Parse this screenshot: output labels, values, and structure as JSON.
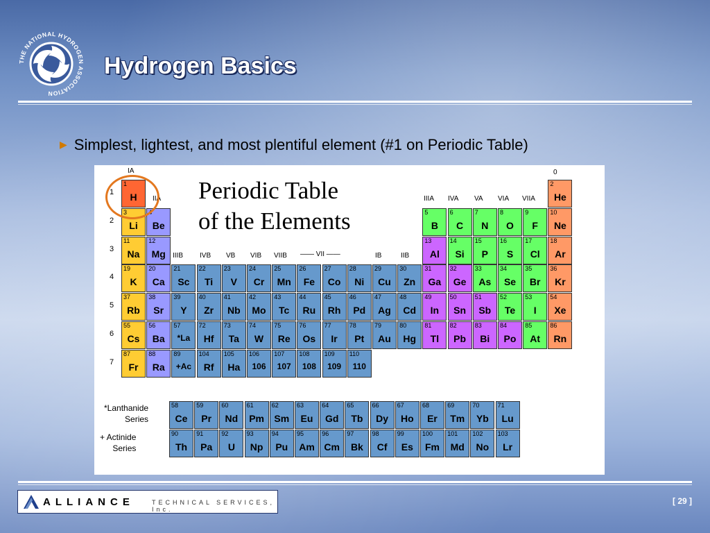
{
  "slide": {
    "title": "Hydrogen Basics",
    "bullet": "Simplest, lightest, and most plentiful element (#1 on Periodic Table)",
    "page_label": "[ 29 ]"
  },
  "logo": {
    "text": "THE NATIONAL HYDROGEN ASSOCIATION",
    "icon": "swirl-logo-icon"
  },
  "footer": {
    "brand": "ALLIANCE",
    "subtitle": "TECHNICAL SERVICES, Inc.",
    "icon": "alliance-a-icon"
  },
  "periodic_table": {
    "title_line1": "Periodic Table",
    "title_line2": "of the Elements",
    "group_labels": [
      "IA",
      "IIA",
      "IIIB",
      "IVB",
      "VB",
      "VIB",
      "VIIB",
      "—— VII ——",
      "IB",
      "IIB",
      "IIIA",
      "IVA",
      "VA",
      "VIA",
      "VIIA",
      "0"
    ],
    "periods": [
      "1",
      "2",
      "3",
      "4",
      "5",
      "6",
      "7"
    ],
    "lanthanide_label": [
      "*Lanthanide",
      "Series"
    ],
    "actinide_label": [
      "+ Actinide",
      "Series"
    ],
    "colors": {
      "hydrogen": "#ff6633",
      "alkali": "#ffcc33",
      "alkaline": "#9999ff",
      "transition": "#6699cc",
      "metalloid": "#cc66ff",
      "nonmetal": "#66ff66",
      "noble": "#ff9966",
      "series": "#6699cc"
    },
    "main": [
      {
        "n": "1",
        "s": "H",
        "c": "hydrogen"
      },
      {
        "n": "2",
        "s": "He",
        "c": "noble"
      },
      {
        "n": "3",
        "s": "Li",
        "c": "alkali"
      },
      {
        "n": "4",
        "s": "Be",
        "c": "alkaline"
      },
      {
        "n": "5",
        "s": "B",
        "c": "nonmetal"
      },
      {
        "n": "6",
        "s": "C",
        "c": "nonmetal"
      },
      {
        "n": "7",
        "s": "N",
        "c": "nonmetal"
      },
      {
        "n": "8",
        "s": "O",
        "c": "nonmetal"
      },
      {
        "n": "9",
        "s": "F",
        "c": "nonmetal"
      },
      {
        "n": "10",
        "s": "Ne",
        "c": "noble"
      },
      {
        "n": "11",
        "s": "Na",
        "c": "alkali"
      },
      {
        "n": "12",
        "s": "Mg",
        "c": "alkaline"
      },
      {
        "n": "13",
        "s": "Al",
        "c": "metalloid"
      },
      {
        "n": "14",
        "s": "Si",
        "c": "nonmetal"
      },
      {
        "n": "15",
        "s": "P",
        "c": "nonmetal"
      },
      {
        "n": "16",
        "s": "S",
        "c": "nonmetal"
      },
      {
        "n": "17",
        "s": "Cl",
        "c": "nonmetal"
      },
      {
        "n": "18",
        "s": "Ar",
        "c": "noble"
      },
      {
        "n": "19",
        "s": "K",
        "c": "alkali"
      },
      {
        "n": "20",
        "s": "Ca",
        "c": "alkaline"
      },
      {
        "n": "21",
        "s": "Sc",
        "c": "transition"
      },
      {
        "n": "22",
        "s": "Ti",
        "c": "transition"
      },
      {
        "n": "23",
        "s": "V",
        "c": "transition"
      },
      {
        "n": "24",
        "s": "Cr",
        "c": "transition"
      },
      {
        "n": "25",
        "s": "Mn",
        "c": "transition"
      },
      {
        "n": "26",
        "s": "Fe",
        "c": "transition"
      },
      {
        "n": "27",
        "s": "Co",
        "c": "transition"
      },
      {
        "n": "28",
        "s": "Ni",
        "c": "transition"
      },
      {
        "n": "29",
        "s": "Cu",
        "c": "transition"
      },
      {
        "n": "30",
        "s": "Zn",
        "c": "transition"
      },
      {
        "n": "31",
        "s": "Ga",
        "c": "metalloid"
      },
      {
        "n": "32",
        "s": "Ge",
        "c": "metalloid"
      },
      {
        "n": "33",
        "s": "As",
        "c": "nonmetal"
      },
      {
        "n": "34",
        "s": "Se",
        "c": "nonmetal"
      },
      {
        "n": "35",
        "s": "Br",
        "c": "nonmetal"
      },
      {
        "n": "36",
        "s": "Kr",
        "c": "noble"
      },
      {
        "n": "37",
        "s": "Rb",
        "c": "alkali"
      },
      {
        "n": "38",
        "s": "Sr",
        "c": "alkaline"
      },
      {
        "n": "39",
        "s": "Y",
        "c": "transition"
      },
      {
        "n": "40",
        "s": "Zr",
        "c": "transition"
      },
      {
        "n": "41",
        "s": "Nb",
        "c": "transition"
      },
      {
        "n": "42",
        "s": "Mo",
        "c": "transition"
      },
      {
        "n": "43",
        "s": "Tc",
        "c": "transition"
      },
      {
        "n": "44",
        "s": "Ru",
        "c": "transition"
      },
      {
        "n": "45",
        "s": "Rh",
        "c": "transition"
      },
      {
        "n": "46",
        "s": "Pd",
        "c": "transition"
      },
      {
        "n": "47",
        "s": "Ag",
        "c": "transition"
      },
      {
        "n": "48",
        "s": "Cd",
        "c": "transition"
      },
      {
        "n": "49",
        "s": "In",
        "c": "metalloid"
      },
      {
        "n": "50",
        "s": "Sn",
        "c": "metalloid"
      },
      {
        "n": "51",
        "s": "Sb",
        "c": "metalloid"
      },
      {
        "n": "52",
        "s": "Te",
        "c": "nonmetal"
      },
      {
        "n": "53",
        "s": "I",
        "c": "nonmetal"
      },
      {
        "n": "54",
        "s": "Xe",
        "c": "noble"
      },
      {
        "n": "55",
        "s": "Cs",
        "c": "alkali"
      },
      {
        "n": "56",
        "s": "Ba",
        "c": "alkaline"
      },
      {
        "n": "57",
        "s": "*La",
        "c": "transition"
      },
      {
        "n": "72",
        "s": "Hf",
        "c": "transition"
      },
      {
        "n": "73",
        "s": "Ta",
        "c": "transition"
      },
      {
        "n": "74",
        "s": "W",
        "c": "transition"
      },
      {
        "n": "75",
        "s": "Re",
        "c": "transition"
      },
      {
        "n": "76",
        "s": "Os",
        "c": "transition"
      },
      {
        "n": "77",
        "s": "Ir",
        "c": "transition"
      },
      {
        "n": "78",
        "s": "Pt",
        "c": "transition"
      },
      {
        "n": "79",
        "s": "Au",
        "c": "transition"
      },
      {
        "n": "80",
        "s": "Hg",
        "c": "transition"
      },
      {
        "n": "81",
        "s": "Tl",
        "c": "metalloid"
      },
      {
        "n": "82",
        "s": "Pb",
        "c": "metalloid"
      },
      {
        "n": "83",
        "s": "Bi",
        "c": "metalloid"
      },
      {
        "n": "84",
        "s": "Po",
        "c": "metalloid"
      },
      {
        "n": "85",
        "s": "At",
        "c": "nonmetal"
      },
      {
        "n": "86",
        "s": "Rn",
        "c": "noble"
      },
      {
        "n": "87",
        "s": "Fr",
        "c": "alkali"
      },
      {
        "n": "88",
        "s": "Ra",
        "c": "alkaline"
      },
      {
        "n": "89",
        "s": "+Ac",
        "c": "transition"
      },
      {
        "n": "104",
        "s": "Rf",
        "c": "transition"
      },
      {
        "n": "105",
        "s": "Ha",
        "c": "transition"
      },
      {
        "n": "106",
        "s": "106",
        "c": "transition"
      },
      {
        "n": "107",
        "s": "107",
        "c": "transition"
      },
      {
        "n": "108",
        "s": "108",
        "c": "transition"
      },
      {
        "n": "109",
        "s": "109",
        "c": "transition"
      },
      {
        "n": "110",
        "s": "110",
        "c": "transition"
      }
    ],
    "lanthanides": [
      {
        "n": "58",
        "s": "Ce"
      },
      {
        "n": "59",
        "s": "Pr"
      },
      {
        "n": "60",
        "s": "Nd"
      },
      {
        "n": "61",
        "s": "Pm"
      },
      {
        "n": "62",
        "s": "Sm"
      },
      {
        "n": "63",
        "s": "Eu"
      },
      {
        "n": "64",
        "s": "Gd"
      },
      {
        "n": "65",
        "s": "Tb"
      },
      {
        "n": "66",
        "s": "Dy"
      },
      {
        "n": "67",
        "s": "Ho"
      },
      {
        "n": "68",
        "s": "Er"
      },
      {
        "n": "69",
        "s": "Tm"
      },
      {
        "n": "70",
        "s": "Yb"
      },
      {
        "n": "71",
        "s": "Lu"
      }
    ],
    "actinides": [
      {
        "n": "90",
        "s": "Th"
      },
      {
        "n": "91",
        "s": "Pa"
      },
      {
        "n": "92",
        "s": "U"
      },
      {
        "n": "93",
        "s": "Np"
      },
      {
        "n": "94",
        "s": "Pu"
      },
      {
        "n": "95",
        "s": "Am"
      },
      {
        "n": "96",
        "s": "Cm"
      },
      {
        "n": "97",
        "s": "Bk"
      },
      {
        "n": "98",
        "s": "Cf"
      },
      {
        "n": "99",
        "s": "Es"
      },
      {
        "n": "100",
        "s": "Fm"
      },
      {
        "n": "101",
        "s": "Md"
      },
      {
        "n": "102",
        "s": "No"
      },
      {
        "n": "103",
        "s": "Lr"
      }
    ]
  }
}
